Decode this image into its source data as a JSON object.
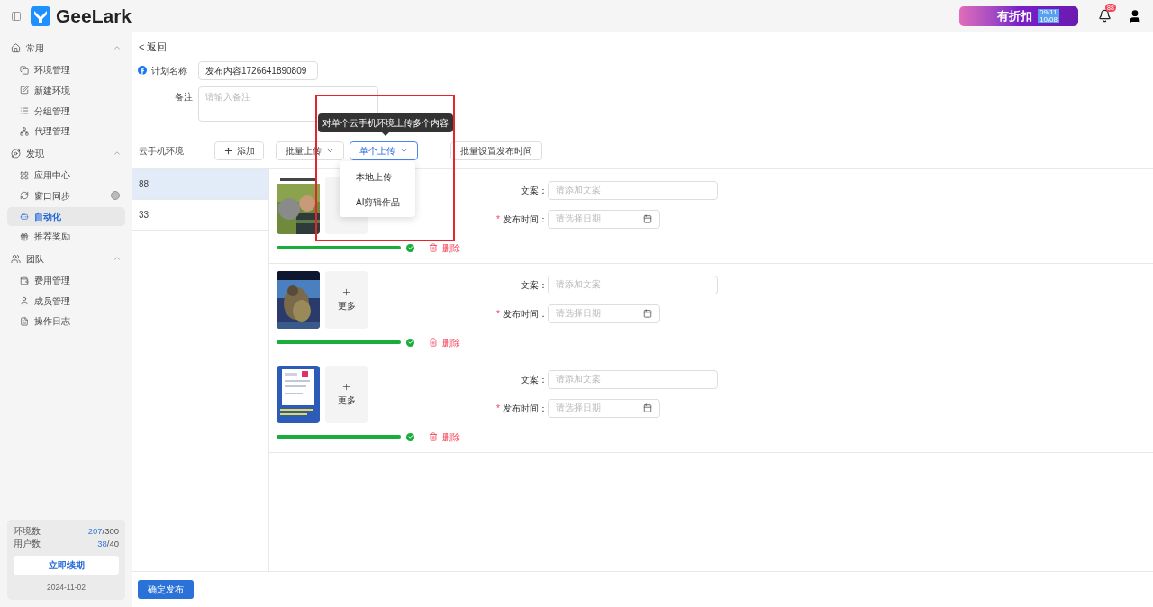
{
  "header": {
    "logo_text": "GeeLark",
    "promo": {
      "text": "有折扣",
      "dates": [
        "09/11",
        "10/08"
      ]
    },
    "notification_count": "88"
  },
  "sidebar": {
    "groups": [
      {
        "label": "常用",
        "expanded": true,
        "items": [
          {
            "label": "环境管理",
            "selected": false
          },
          {
            "label": "新建环境",
            "selected": false
          },
          {
            "label": "分组管理",
            "selected": false
          },
          {
            "label": "代理管理",
            "selected": false
          }
        ]
      },
      {
        "label": "发现",
        "expanded": true,
        "items": [
          {
            "label": "应用中心",
            "selected": false
          },
          {
            "label": "窗口同步",
            "selected": false,
            "badge": true
          },
          {
            "label": "自动化",
            "selected": true
          },
          {
            "label": "推荐奖励",
            "selected": false
          }
        ]
      },
      {
        "label": "团队",
        "expanded": true,
        "items": [
          {
            "label": "费用管理",
            "selected": false
          },
          {
            "label": "成员管理",
            "selected": false
          },
          {
            "label": "操作日志",
            "selected": false
          }
        ]
      }
    ],
    "quota": {
      "rows": [
        {
          "label": "环境数",
          "used": "207",
          "total": "/300"
        },
        {
          "label": "用户数",
          "used": "38",
          "total": "/40"
        }
      ],
      "renew_button": "立即续期",
      "expiry": "2024-11-02"
    }
  },
  "back_link": "< 返回",
  "form": {
    "name_label": "计划名称",
    "name_value": "发布内容1726641890809",
    "note_label": "备注",
    "note_placeholder": "请输入备注"
  },
  "toolbar": {
    "env_label": "云手机环境",
    "add_button": "添加",
    "buttons": [
      {
        "label": "批量上传",
        "kind": "dropdown",
        "selected": false
      },
      {
        "label": "单个上传",
        "kind": "dropdown",
        "selected": true
      },
      {
        "label": "批量设置发布时间",
        "kind": "plain",
        "selected": false
      }
    ],
    "tooltip": "对单个云手机环境上传多个内容",
    "menu": [
      "本地上传",
      "AI剪辑作品"
    ]
  },
  "environments": [
    {
      "label": "88",
      "selected": true
    },
    {
      "label": "33",
      "selected": false
    }
  ],
  "posts": [
    {
      "caption_label": "文案：",
      "caption_placeholder": "请添加文案",
      "required": true,
      "required_mark": "*",
      "time_label": "发布时间：",
      "time_placeholder": "请选择日期",
      "level": 1,
      "delete": "删除"
    },
    {
      "more_label": "更多",
      "caption_label": "文案：",
      "caption_placeholder": "请添加文案",
      "required": true,
      "required_mark": "*",
      "time_label": "发布时间：",
      "time_placeholder": "请选择日期",
      "level": 1,
      "delete": "删除"
    },
    {
      "more_label": "更多",
      "caption_label": "文案：",
      "caption_placeholder": "请添加文案",
      "required": true,
      "required_mark": "*",
      "time_label": "发布时间：",
      "time_placeholder": "请选择日期",
      "level": 1,
      "delete": "删除"
    }
  ],
  "submit_button": "确定发布"
}
